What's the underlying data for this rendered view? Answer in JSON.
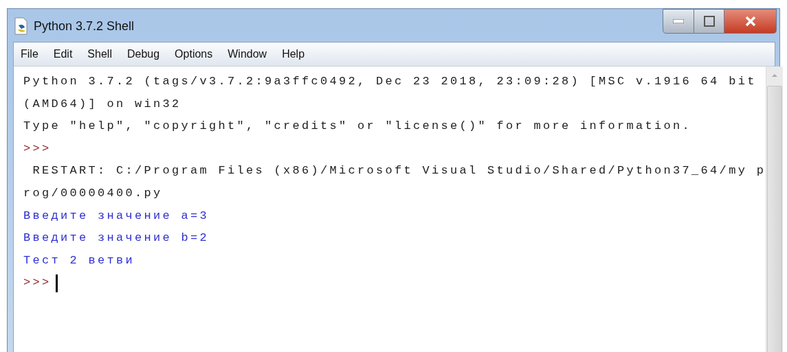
{
  "window": {
    "title": "Python 3.7.2 Shell"
  },
  "menu": [
    "File",
    "Edit",
    "Shell",
    "Debug",
    "Options",
    "Window",
    "Help"
  ],
  "lines": [
    {
      "kind": "output",
      "text": "Python 3.7.2 (tags/v3.7.2:9a3ffc0492, Dec 23 2018, 23:09:28) [MSC v.1916 64 bit"
    },
    {
      "kind": "output",
      "text": "(AMD64)] on win32"
    },
    {
      "kind": "output",
      "text": "Type \"help\", \"copyright\", \"credits\" or \"license()\" for more information."
    },
    {
      "kind": "prompt",
      "text": ">>>"
    },
    {
      "kind": "output",
      "text": " RESTART: C:/Program Files (x86)/Microsoft Visual Studio/Shared/Python37_64/my p"
    },
    {
      "kind": "output",
      "text": "rog/00000400.py"
    },
    {
      "kind": "stdout",
      "text": "Введите значение a=3"
    },
    {
      "kind": "stdout",
      "text": "Введите значение b=2"
    },
    {
      "kind": "stdout",
      "text": "Тест 2 ветви"
    },
    {
      "kind": "prompt",
      "text": ">>>",
      "cursor": true
    }
  ]
}
